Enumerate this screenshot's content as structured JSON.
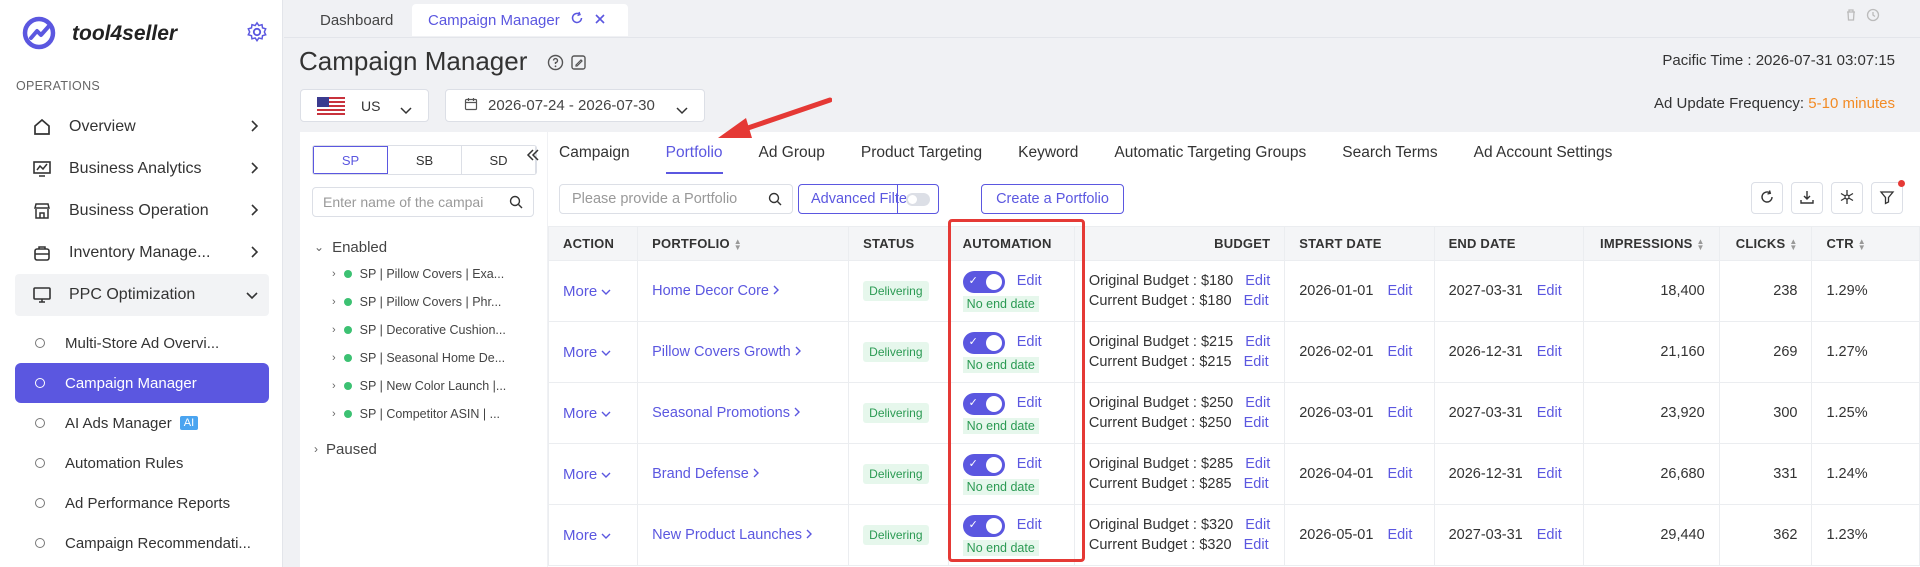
{
  "brand": {
    "name": "tool4seller"
  },
  "sidebar": {
    "section": "OPERATIONS",
    "items": [
      {
        "label": "Overview"
      },
      {
        "label": "Business Analytics"
      },
      {
        "label": "Business Operation"
      },
      {
        "label": "Inventory Manage..."
      },
      {
        "label": "PPC Optimization"
      }
    ],
    "sub_items": [
      {
        "label": "Multi-Store Ad Overvi..."
      },
      {
        "label": "Campaign Manager"
      },
      {
        "label": "AI Ads Manager",
        "badge": "AI"
      },
      {
        "label": "Automation Rules"
      },
      {
        "label": "Ad Performance Reports"
      },
      {
        "label": "Campaign Recommendati..."
      }
    ]
  },
  "tabs": [
    {
      "label": "Dashboard"
    },
    {
      "label": "Campaign Manager"
    }
  ],
  "header": {
    "title": "Campaign Manager",
    "pacific_time": "Pacific Time : 2026-07-31 03:07:15",
    "ad_update_label": "Ad Update Frequency: ",
    "ad_update_value": "5-10 minutes",
    "country": "US",
    "date_range": "2026-07-24 - 2026-07-30"
  },
  "left_panel": {
    "segments": [
      "SP",
      "SB",
      "SD"
    ],
    "search_placeholder": "Enter name of the campai",
    "enabled_label": "Enabled",
    "paused_label": "Paused",
    "campaigns": [
      "SP | Pillow Covers | Exa...",
      "SP | Pillow Covers | Phr...",
      "SP | Decorative Cushion...",
      "SP | Seasonal Home De...",
      "SP | New Color Launch |...",
      "SP | Competitor ASIN | ..."
    ]
  },
  "main": {
    "function_tabs": [
      "Campaign",
      "Portfolio",
      "Ad Group",
      "Product Targeting",
      "Keyword",
      "Automatic Targeting Groups",
      "Search Terms",
      "Ad Account Settings"
    ],
    "portfolio_search_placeholder": "Please provide a Portfolio",
    "advanced_filter": "Advanced Filter",
    "create_portfolio": "Create a Portfolio",
    "columns": {
      "action": "ACTION",
      "portfolio": "PORTFOLIO",
      "status": "STATUS",
      "automation": "AUTOMATION",
      "budget": "BUDGET",
      "start_date": "START DATE",
      "end_date": "END DATE",
      "impressions": "IMPRESSIONS",
      "clicks": "CLICKS",
      "ctr": "CTR"
    },
    "labels": {
      "more": "More",
      "edit": "Edit",
      "no_end_date": "No end date",
      "original_budget": "Original Budget : ",
      "current_budget": "Current Budget : "
    },
    "rows": [
      {
        "portfolio": "Home Decor Core",
        "status": "Delivering",
        "original_budget": "$180",
        "current_budget": "$180",
        "start": "2026-01-01",
        "end": "2027-03-31",
        "impressions": "18,400",
        "clicks": "238",
        "ctr": "1.29%"
      },
      {
        "portfolio": "Pillow Covers Growth",
        "status": "Delivering",
        "original_budget": "$215",
        "current_budget": "$215",
        "start": "2026-02-01",
        "end": "2026-12-31",
        "impressions": "21,160",
        "clicks": "269",
        "ctr": "1.27%"
      },
      {
        "portfolio": "Seasonal Promotions",
        "status": "Delivering",
        "original_budget": "$250",
        "current_budget": "$250",
        "start": "2026-03-01",
        "end": "2027-03-31",
        "impressions": "23,920",
        "clicks": "300",
        "ctr": "1.25%"
      },
      {
        "portfolio": "Brand Defense",
        "status": "Delivering",
        "original_budget": "$285",
        "current_budget": "$285",
        "start": "2026-04-01",
        "end": "2026-12-31",
        "impressions": "26,680",
        "clicks": "331",
        "ctr": "1.24%"
      },
      {
        "portfolio": "New Product Launches",
        "status": "Delivering",
        "original_budget": "$320",
        "current_budget": "$320",
        "start": "2026-05-01",
        "end": "2027-03-31",
        "impressions": "29,440",
        "clicks": "362",
        "ctr": "1.23%"
      }
    ]
  },
  "colors": {
    "accent": "#5b57e0",
    "highlight": "#e53935",
    "status_green": "#2b9a53",
    "warning": "#f28b25"
  }
}
